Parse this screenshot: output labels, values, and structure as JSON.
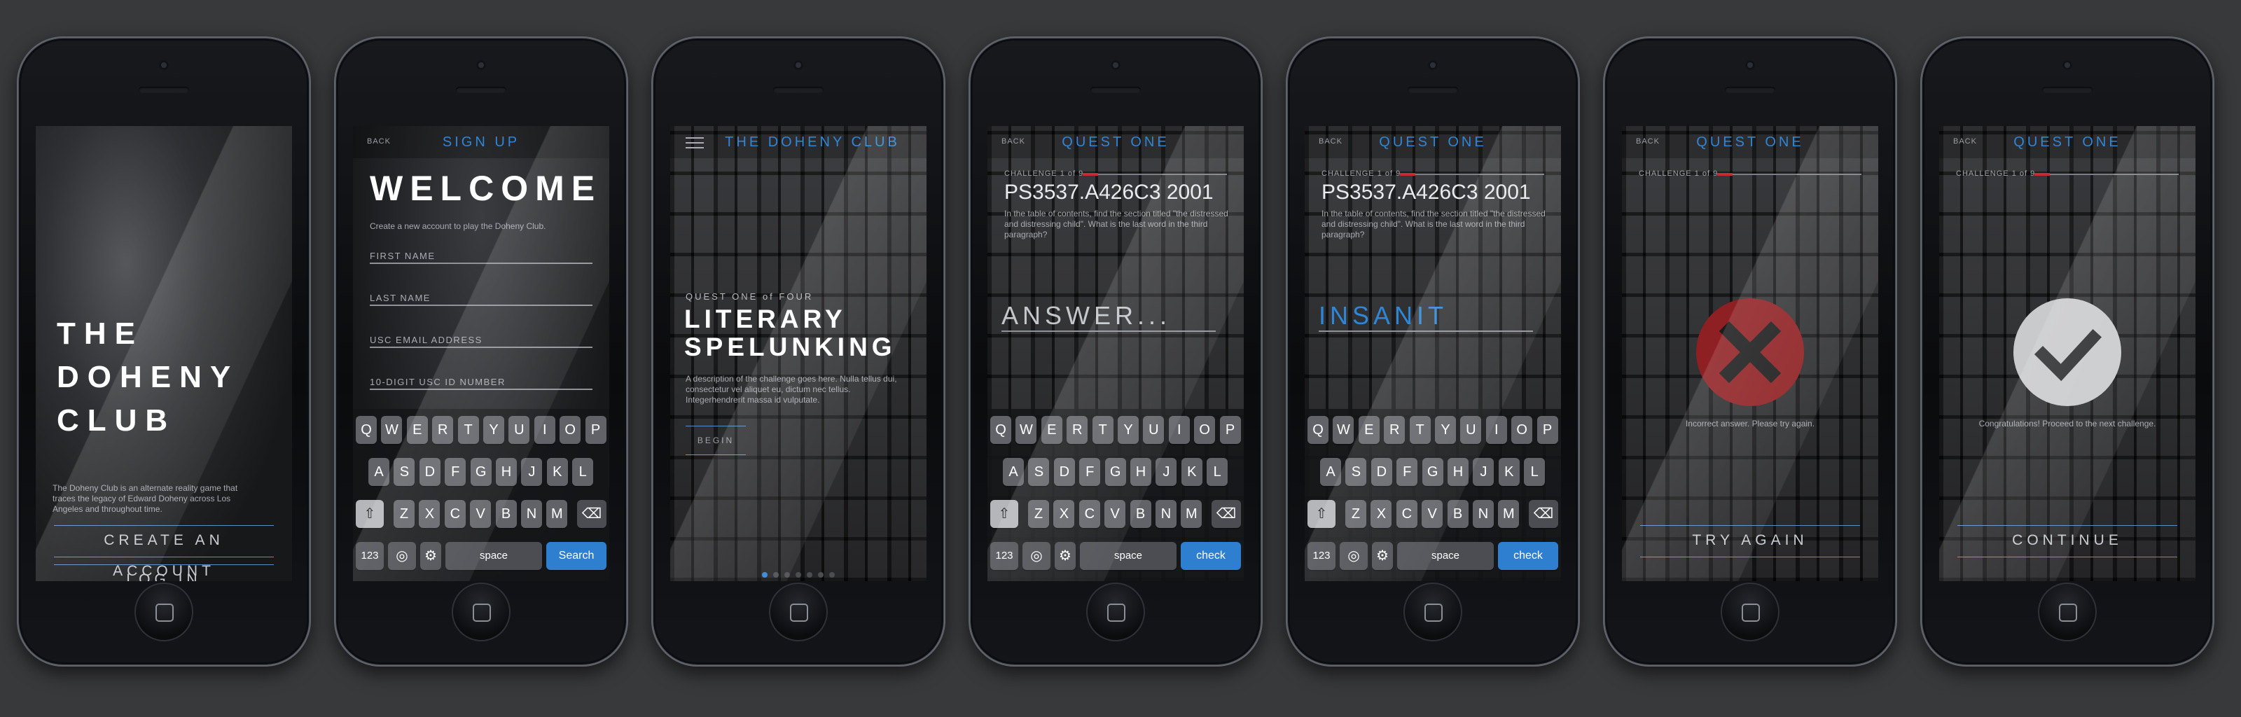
{
  "screens": {
    "s1": {
      "title_lines": [
        "THE",
        "DOHENY",
        "CLUB"
      ],
      "description": "The Doheny Club is an alternate reality game that traces the legacy of Edward Doheny across Los Angeles and throughout time.",
      "create_account": "CREATE AN ACCOUNT",
      "login": "LOG IN"
    },
    "s2": {
      "back": "BACK",
      "title": "SIGN UP",
      "welcome": "WELCOME",
      "subtitle": "Create a new account to play the Doheny Club.",
      "fields": [
        "FIRST NAME",
        "LAST NAME",
        "USC EMAIL ADDRESS",
        "10-DIGIT USC ID NUMBER"
      ],
      "action_key": "Search"
    },
    "s3": {
      "title": "THE DOHENY CLUB",
      "quest_label": "QUEST ONE of FOUR",
      "quest_title_1": "LITERARY",
      "quest_title_2": "SPELUNKING",
      "description": "A description of the challenge goes here. Nulla tellus dui, consectetur vel aliquet eu, dictum nec tellus. Integerhendrerit massa id vulputate.",
      "begin": "BEGIN",
      "page_dots": 7,
      "active_dot": 0
    },
    "s4": {
      "back": "BACK",
      "title": "QUEST ONE",
      "challenge": "CHALLENGE 1 of 9",
      "code": "PS3537.A426C3 2001",
      "prompt": "In the table of contents, find the section titled \"the distressed and distressing child\". What is the last word in the third paragraph?",
      "answer_placeholder": "ANSWER...",
      "action_key": "check"
    },
    "s5": {
      "back": "BACK",
      "title": "QUEST ONE",
      "challenge": "CHALLENGE 1 of 9",
      "code": "PS3537.A426C3 2001",
      "prompt": "In the table of contents, find the section titled \"the distressed and distressing child\". What is the last word in the third paragraph?",
      "answer_value": "INSANIT",
      "action_key": "check"
    },
    "s6": {
      "back": "BACK",
      "title": "QUEST ONE",
      "challenge": "CHALLENGE 1 of 9",
      "message": "Incorrect answer. Please try again.",
      "button": "TRY AGAIN"
    },
    "s7": {
      "back": "BACK",
      "title": "QUEST ONE",
      "challenge": "CHALLENGE 1 of 9",
      "message": "Congratulations! Proceed to the next challenge.",
      "button": "CONTINUE"
    }
  },
  "keyboard": {
    "row1": [
      "Q",
      "W",
      "E",
      "R",
      "T",
      "Y",
      "U",
      "I",
      "O",
      "P"
    ],
    "row2": [
      "A",
      "S",
      "D",
      "F",
      "G",
      "H",
      "J",
      "K",
      "L"
    ],
    "row3": [
      "Z",
      "X",
      "C",
      "V",
      "B",
      "N",
      "M"
    ],
    "numbers_key": "123",
    "space_key": "space"
  },
  "colors": {
    "accent": "#2f86d6",
    "error": "#a3262a",
    "success": "#c9cacc"
  }
}
